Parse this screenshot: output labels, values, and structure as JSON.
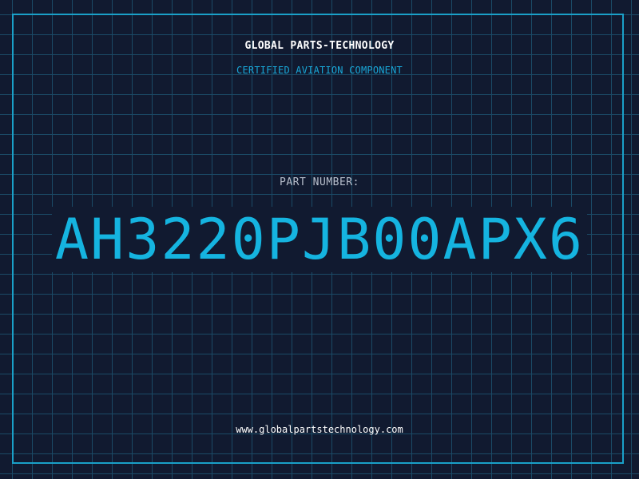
{
  "header": {
    "brand": "GLOBAL PARTS-TECHNOLOGY",
    "tagline": "CERTIFIED AVIATION COMPONENT"
  },
  "main": {
    "label": "PART NUMBER:",
    "part_number": "AH3220PJB00APX6"
  },
  "footer": {
    "website": "www.globalpartstechnology.com"
  },
  "colors": {
    "background": "#111a30",
    "grid": "#1b4a66",
    "accent": "#15b4e0",
    "border": "#1aa0c8",
    "text": "#ffffff"
  }
}
